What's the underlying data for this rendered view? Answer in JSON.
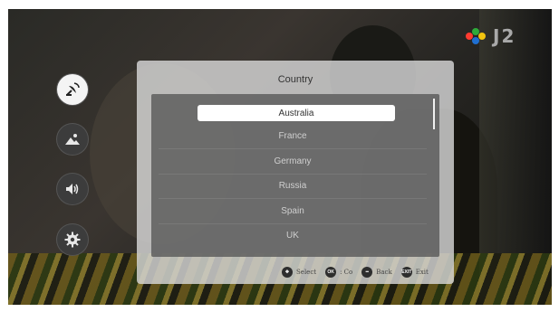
{
  "logo": {
    "text": "J2",
    "colors": [
      "#ff3b30",
      "#2eaa3a",
      "#1f6fd1"
    ]
  },
  "sidebar": {
    "items": [
      {
        "name": "satellite",
        "icon": "satellite-icon",
        "active": true
      },
      {
        "name": "picture",
        "icon": "picture-icon",
        "active": false
      },
      {
        "name": "sound",
        "icon": "speaker-icon",
        "active": false
      },
      {
        "name": "settings",
        "icon": "gear-icon",
        "active": false
      }
    ]
  },
  "dialog": {
    "title": "Country",
    "selected_index": 0,
    "options": [
      "Australia",
      "France",
      "Germany",
      "Russia",
      "Spain",
      "UK"
    ]
  },
  "hints": [
    {
      "icon": "dpad-icon",
      "icon_text": "",
      "label": "Select"
    },
    {
      "icon": "ok-icon",
      "icon_text": "OK",
      "label": ": Co"
    },
    {
      "icon": "back-icon",
      "icon_text": "",
      "label": "Back"
    },
    {
      "icon": "exit-icon",
      "icon_text": "EXIT",
      "label": "Exit"
    }
  ],
  "colors": {
    "selected_row_bg": "#ffffff",
    "active_icon_bg": "#f4f4f4"
  }
}
